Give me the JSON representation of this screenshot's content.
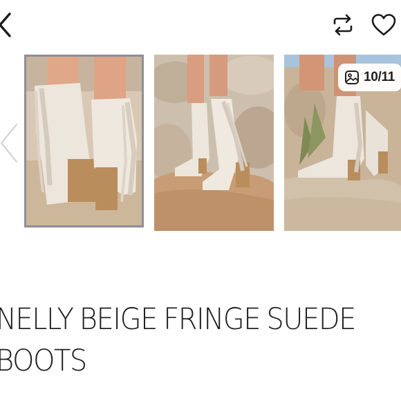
{
  "header": {
    "back_icon": "chevron-left-icon",
    "repost_icon": "repost-icon",
    "like_icon": "heart-icon"
  },
  "gallery": {
    "counter": "10/11",
    "counter_icon": "gallery-icon",
    "prev_icon": "chevron-left-icon",
    "images": [
      {
        "alt": "beige fringe boots back view"
      },
      {
        "alt": "beige fringe boots side view"
      },
      {
        "alt": "beige fringe boot on rock"
      }
    ]
  },
  "product": {
    "title_line1": "NELLY BEIGE FRINGE SUEDE",
    "title_line2": "BOOTS"
  },
  "colors": {
    "selected_border": "#8e8e96",
    "boot": "#ece6dc",
    "heel": "#b98d5c"
  }
}
